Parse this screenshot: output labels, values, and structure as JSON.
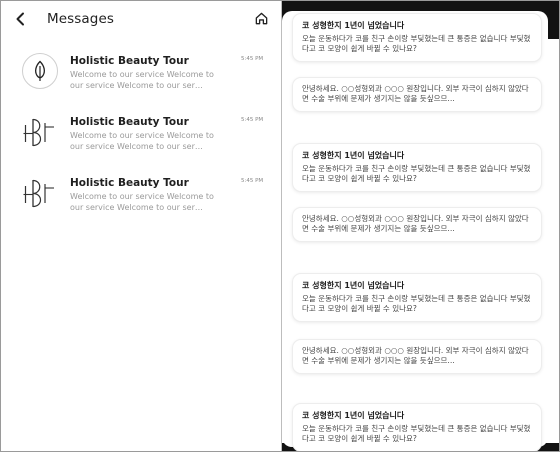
{
  "header": {
    "title": "Messages",
    "back_icon": "chevron-left-icon",
    "home_icon": "home-icon"
  },
  "conversations": [
    {
      "avatar": "leaf-logo-icon",
      "name": "Holistic Beauty Tour",
      "time": "5:45 PM",
      "preview": "Welcome to our service Welcome to our service Welcome to our ser…"
    },
    {
      "avatar": "hb-monogram-icon",
      "name": "Holistic Beauty Tour",
      "time": "5:45 PM",
      "preview": "Welcome to our service Welcome to our service Welcome to our ser…"
    },
    {
      "avatar": "hb-monogram-icon",
      "name": "Holistic Beauty Tour",
      "time": "5:45 PM",
      "preview": "Welcome to our service Welcome to our service Welcome to our ser…"
    }
  ],
  "thread": {
    "question_title": "코 성형한지 1년이 넘었습니다",
    "question_body": "오늘 운동하다가 코를 친구 손이랑 부딪혔는데 큰 통증은 없습니다 부딪혔다고 코 모양이 쉽게 바뀔 수 있나요?",
    "answer_body": "안녕하세요. ○○성형외과 ○○○ 원장입니다. 외부 자극이 심하지 않았다면 수술 부위에 문제가 생기지는 않을 듯싶으므…"
  },
  "colors": {
    "bar_dark": "#121212",
    "text_primary": "#1f1f1f",
    "text_muted": "#9a9a9a"
  }
}
